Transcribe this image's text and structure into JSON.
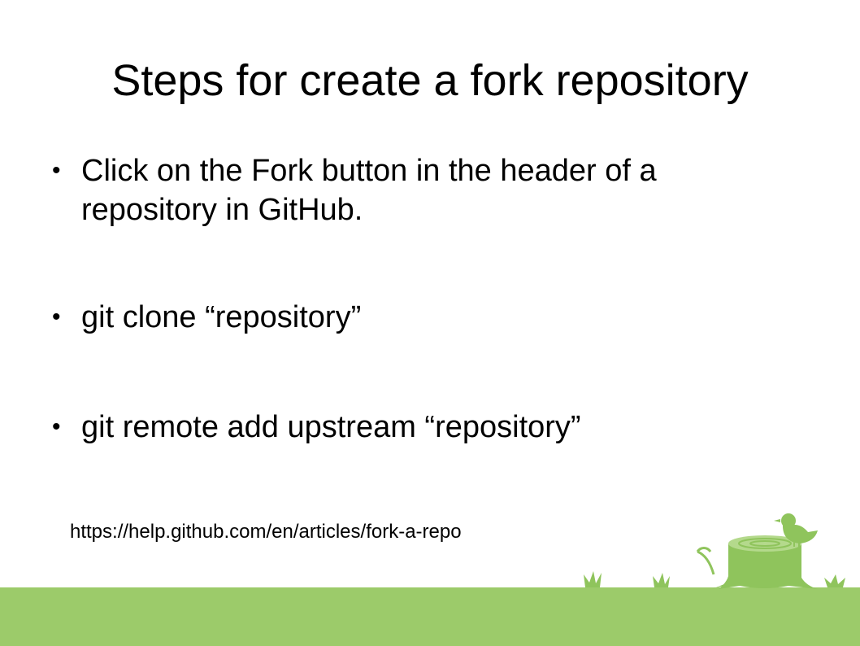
{
  "slide": {
    "title": "Steps for create a fork repository",
    "bullets": [
      {
        "marker": "•",
        "text": "Click on the Fork button in the header of a repository in GitHub."
      },
      {
        "marker": "•",
        "text": "git clone “repository”"
      },
      {
        "marker": "•",
        "text": "git remote add upstream “repository”"
      }
    ],
    "source_url": "https://help.github.com/en/articles/fork-a-repo"
  },
  "decoration": {
    "icons": [
      "grass-icon",
      "tree-stump-icon",
      "bird-icon",
      "sprout-icon"
    ],
    "ground_color": "#9ccb6a",
    "accent_color": "#8fc45c"
  }
}
